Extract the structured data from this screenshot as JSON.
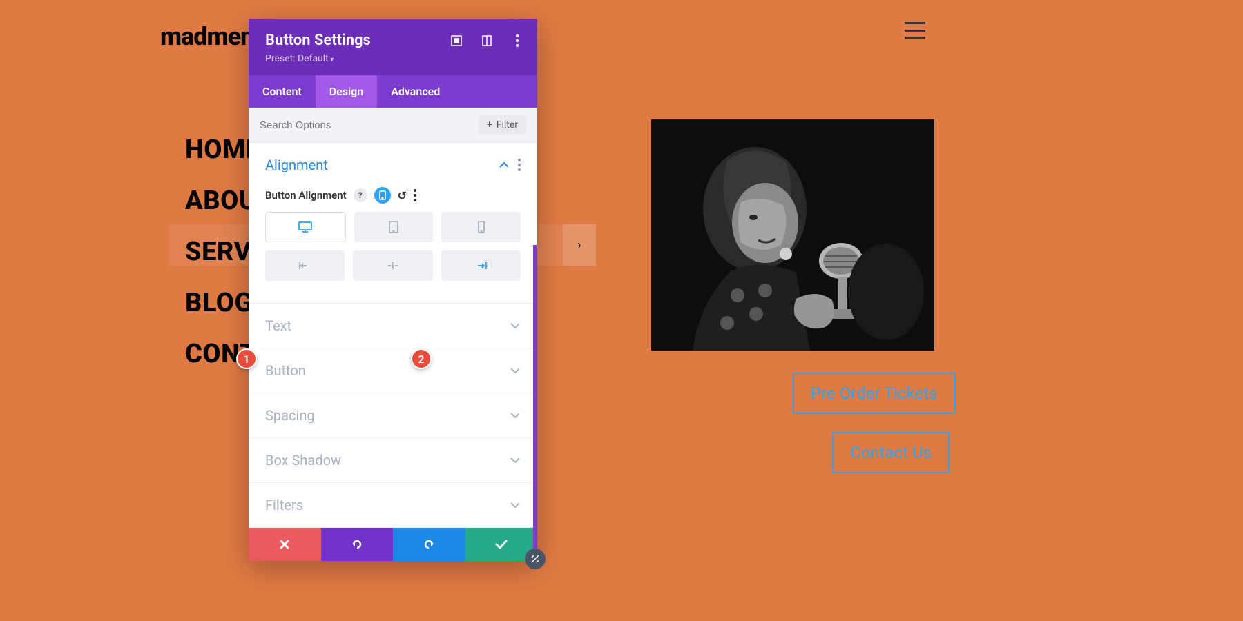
{
  "brand": {
    "logo": "madmenu"
  },
  "nav": {
    "items": [
      "HOME",
      "ABOUT",
      "SERVICES",
      "BLOG",
      "CONTACT"
    ]
  },
  "cta": {
    "preorder": "Pre Order Tickets",
    "contact": "Contact Us"
  },
  "modal": {
    "title": "Button Settings",
    "preset": "Preset: Default",
    "tabs": {
      "content": "Content",
      "design": "Design",
      "advanced": "Advanced"
    },
    "search_placeholder": "Search Options",
    "filter_label": "Filter",
    "sections": {
      "alignment": {
        "title": "Alignment",
        "field_label": "Button Alignment"
      },
      "text": "Text",
      "button": "Button",
      "spacing": "Spacing",
      "box_shadow": "Box Shadow",
      "filters": "Filters"
    }
  },
  "annotations": {
    "one": "1",
    "two": "2"
  }
}
